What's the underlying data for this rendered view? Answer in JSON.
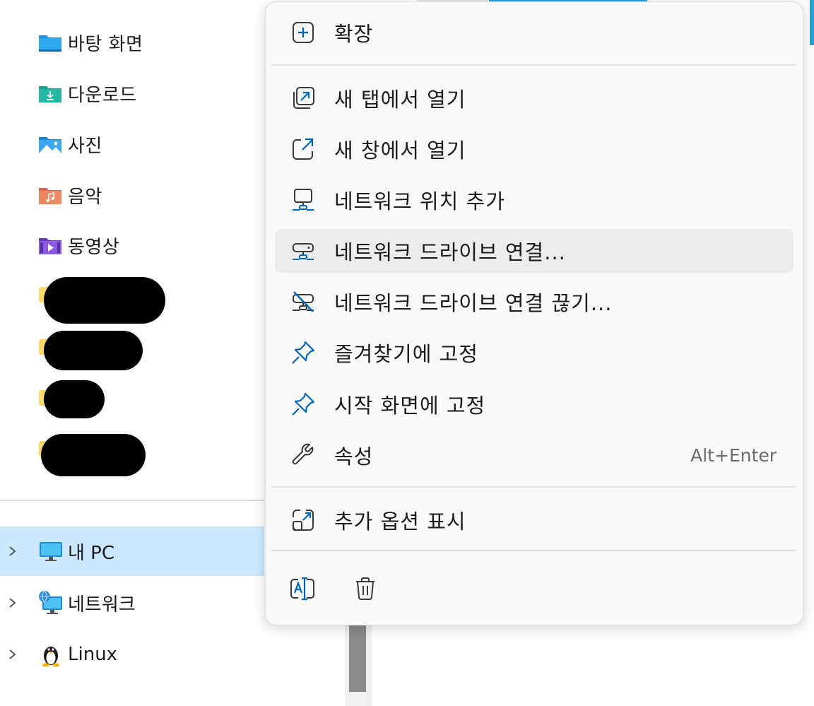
{
  "navigation": {
    "quick_access": [
      {
        "label": "바탕 화면",
        "icon": "desktop-folder-icon"
      },
      {
        "label": "다운로드",
        "icon": "downloads-folder-icon"
      },
      {
        "label": "사진",
        "icon": "pictures-folder-icon"
      },
      {
        "label": "음악",
        "icon": "music-folder-icon"
      },
      {
        "label": "동영상",
        "icon": "videos-folder-icon"
      }
    ],
    "tree": [
      {
        "label": "내 PC",
        "icon": "computer-icon",
        "selected": true
      },
      {
        "label": "네트워크",
        "icon": "network-icon",
        "selected": false
      },
      {
        "label": "Linux",
        "icon": "linux-penguin-icon",
        "selected": false
      }
    ]
  },
  "context_menu": {
    "expand": {
      "label": "확장",
      "icon": "expand-plus-icon"
    },
    "items": [
      {
        "label": "새 탭에서 열기",
        "icon": "open-new-tab-icon"
      },
      {
        "label": "새 창에서 열기",
        "icon": "open-new-window-icon"
      },
      {
        "label": "네트워크 위치 추가",
        "icon": "add-network-location-icon"
      },
      {
        "label": "네트워크 드라이브 연결...",
        "icon": "map-network-drive-icon"
      },
      {
        "label": "네트워크 드라이브 연결 끊기...",
        "icon": "disconnect-network-drive-icon"
      },
      {
        "label": "즐겨찾기에 고정",
        "icon": "pin-icon"
      },
      {
        "label": "시작 화면에 고정",
        "icon": "pin-icon"
      },
      {
        "label": "속성",
        "icon": "wrench-icon",
        "shortcut": "Alt+Enter"
      }
    ],
    "more": {
      "label": "추가 옵션 표시",
      "icon": "show-more-options-icon"
    },
    "bottom_actions": [
      {
        "icon": "rename-icon"
      },
      {
        "icon": "delete-trash-icon"
      }
    ]
  },
  "colors": {
    "accent": "#0067c0",
    "selection": "#cce8ff",
    "menu_background": "#f9f9f9",
    "hover": "#ececec"
  }
}
